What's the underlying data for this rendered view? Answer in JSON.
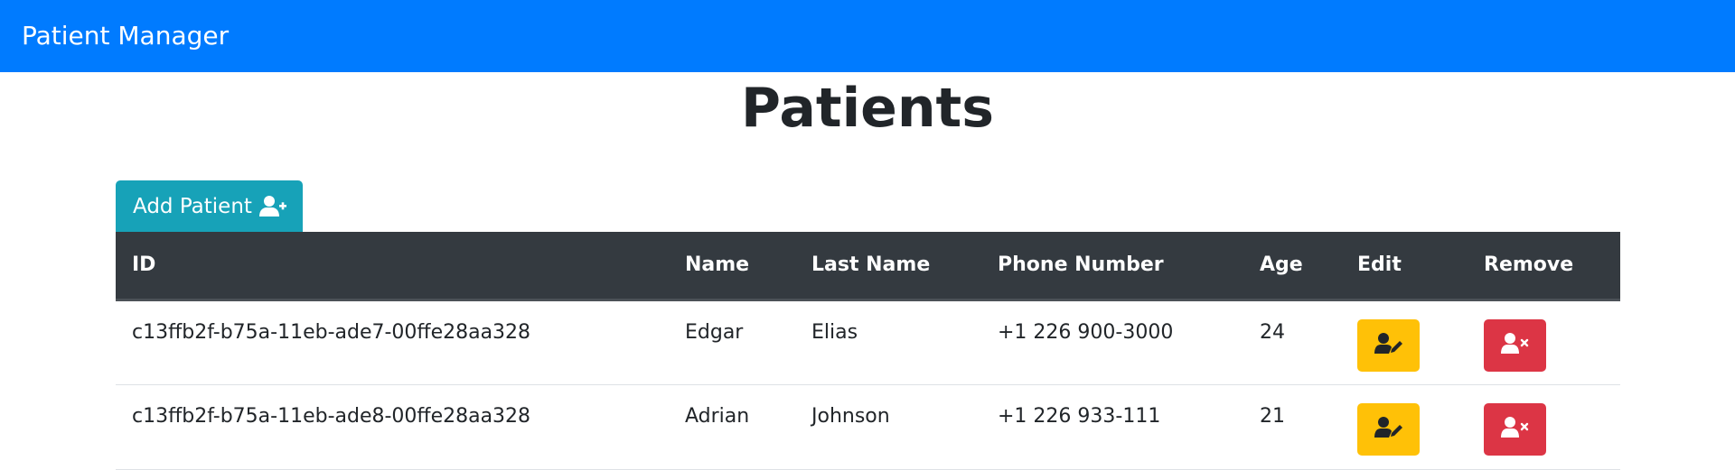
{
  "navbar": {
    "brand": "Patient Manager",
    "brand_color": "#007bff"
  },
  "page": {
    "title": "Patients"
  },
  "toolbar": {
    "add_label": "Add Patient",
    "add_icon": "user-plus-icon",
    "add_color": "#17a2b8"
  },
  "table": {
    "headers": {
      "id": "ID",
      "name": "Name",
      "last_name": "Last Name",
      "phone": "Phone Number",
      "age": "Age",
      "edit": "Edit",
      "remove": "Remove"
    },
    "rows": [
      {
        "id": "c13ffb2f-b75a-11eb-ade7-00ffe28aa328",
        "name": "Edgar",
        "last_name": "Elias",
        "phone": "+1 226 900-3000",
        "age": "24"
      },
      {
        "id": "c13ffb2f-b75a-11eb-ade8-00ffe28aa328",
        "name": "Adrian",
        "last_name": "Johnson",
        "phone": "+1 226 933-111",
        "age": "21"
      }
    ],
    "edit_icon": "user-edit-icon",
    "remove_icon": "user-times-icon",
    "edit_color": "#ffc107",
    "remove_color": "#dc3545",
    "header_color": "#343a40"
  }
}
